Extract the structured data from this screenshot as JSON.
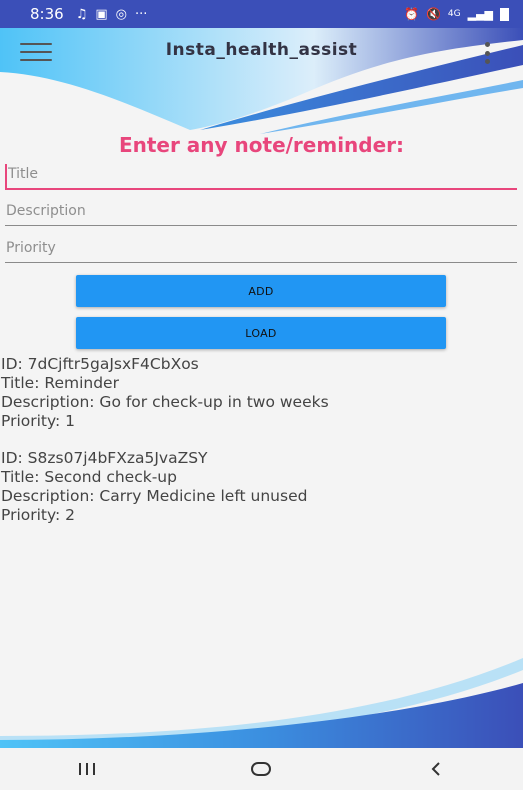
{
  "status_bar": {
    "time": "8:36",
    "icons": [
      "music-note-icon",
      "image-icon",
      "instagram-icon",
      "more-icon",
      "alarm-icon",
      "mute-icon",
      "4g-icon",
      "signal-icon",
      "battery-icon"
    ],
    "network": "4G"
  },
  "app_bar": {
    "title": "Insta_health_assist",
    "menu_icon": "hamburger-menu-icon",
    "overflow_icon": "overflow-menu-icon"
  },
  "form": {
    "heading": "Enter any note/reminder:",
    "title_placeholder": "Title",
    "description_placeholder": "Description",
    "priority_placeholder": "Priority",
    "add_label": "ADD",
    "load_label": "LOAD"
  },
  "notes": [
    {
      "id_line": "ID: 7dCjftr5gaJsxF4CbXos",
      "title_line": "Title: Reminder",
      "description_line": "Description: Go for check-up in two weeks",
      "priority_line": "Priority: 1"
    },
    {
      "id_line": "ID: S8zs07j4bFXza5JvaZSY",
      "title_line": "Title: Second check-up",
      "description_line": "Description: Carry Medicine left unused",
      "priority_line": "Priority: 2"
    }
  ],
  "nav_bar": {
    "recents_icon": "recents-icon",
    "home_icon": "home-icon",
    "back_icon": "back-icon"
  },
  "colors": {
    "accent_pink": "#e8467c",
    "button_blue": "#2196f3",
    "wave_blue": "#3b4fb8",
    "wave_light": "#4fc3f7"
  }
}
